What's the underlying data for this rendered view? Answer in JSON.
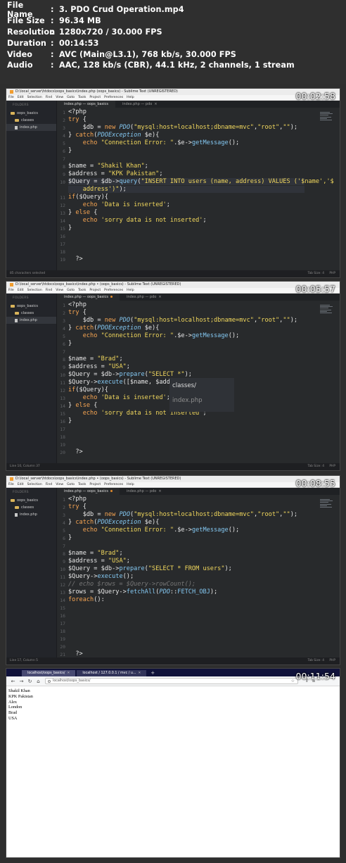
{
  "media_info": [
    {
      "key": "File Name",
      "value": "3. PDO Crud Operation.mp4"
    },
    {
      "key": "File Size",
      "value": "96.34 MB"
    },
    {
      "key": "Resolution",
      "value": "1280x720 / 30.000 FPS"
    },
    {
      "key": "Duration",
      "value": "00:14:53"
    },
    {
      "key": "Video",
      "value": "AVC (Main@L3.1), 768 kb/s, 30.000 FPS"
    },
    {
      "key": "Audio",
      "value": "AAC, 128 kb/s (CBR), 44.1 kHz, 2 channels, 1 stream"
    }
  ],
  "editor_common": {
    "menu": [
      "File",
      "Edit",
      "Selection",
      "Find",
      "View",
      "Goto",
      "Tools",
      "Project",
      "Preferences",
      "Help"
    ],
    "sidebar_header": "FOLDERS",
    "folder": "oops_basics",
    "subfolder": "classes",
    "file": "index.php"
  },
  "frames": [
    {
      "timestamp": "00:02:58",
      "title": "D:\\local_server\\htdocs\\oops_basics\\index.php (oops_basics) - Sublime Text (UNREGISTERED)",
      "tabs": [
        "index.php — oops_basics",
        "index.php — pdo"
      ],
      "status_left": "85 characters selected",
      "status_right": "Tab Size: 4",
      "status_lang": "PHP"
    },
    {
      "timestamp": "00:05:57",
      "title": "D:\\local_server\\htdocs\\oops_basics\\index.php • (oops_basics) - Sublime Text (UNREGISTERED)",
      "tabs": [
        "index.php — oops_basics",
        "index.php — pdo"
      ],
      "status_left": "Line 10, Column 37",
      "status_right": "Tab Size: 4",
      "status_lang": "PHP",
      "autocomplete": [
        "classes/",
        "index.php"
      ]
    },
    {
      "timestamp": "00:08:55",
      "title": "D:\\local_server\\htdocs\\oops_basics\\index.php • (oops_basics) - Sublime Text (UNREGISTERED)",
      "tabs": [
        "index.php — oops_basics",
        "index.php — pdo"
      ],
      "status_left": "Line 17, Column 5",
      "status_right": "Tab Size: 4",
      "status_lang": "PHP"
    },
    {
      "timestamp": "00:11:54",
      "browser": {
        "tabs": [
          "localhost/oops_basics/",
          "localhost / 127.0.0.1 / mvc / u..."
        ],
        "url": "localhost/oops_basics/",
        "output": [
          "Shakil Khan",
          "KPK Pakistan",
          "Alex",
          "London",
          "Brad",
          "USA"
        ]
      }
    }
  ]
}
